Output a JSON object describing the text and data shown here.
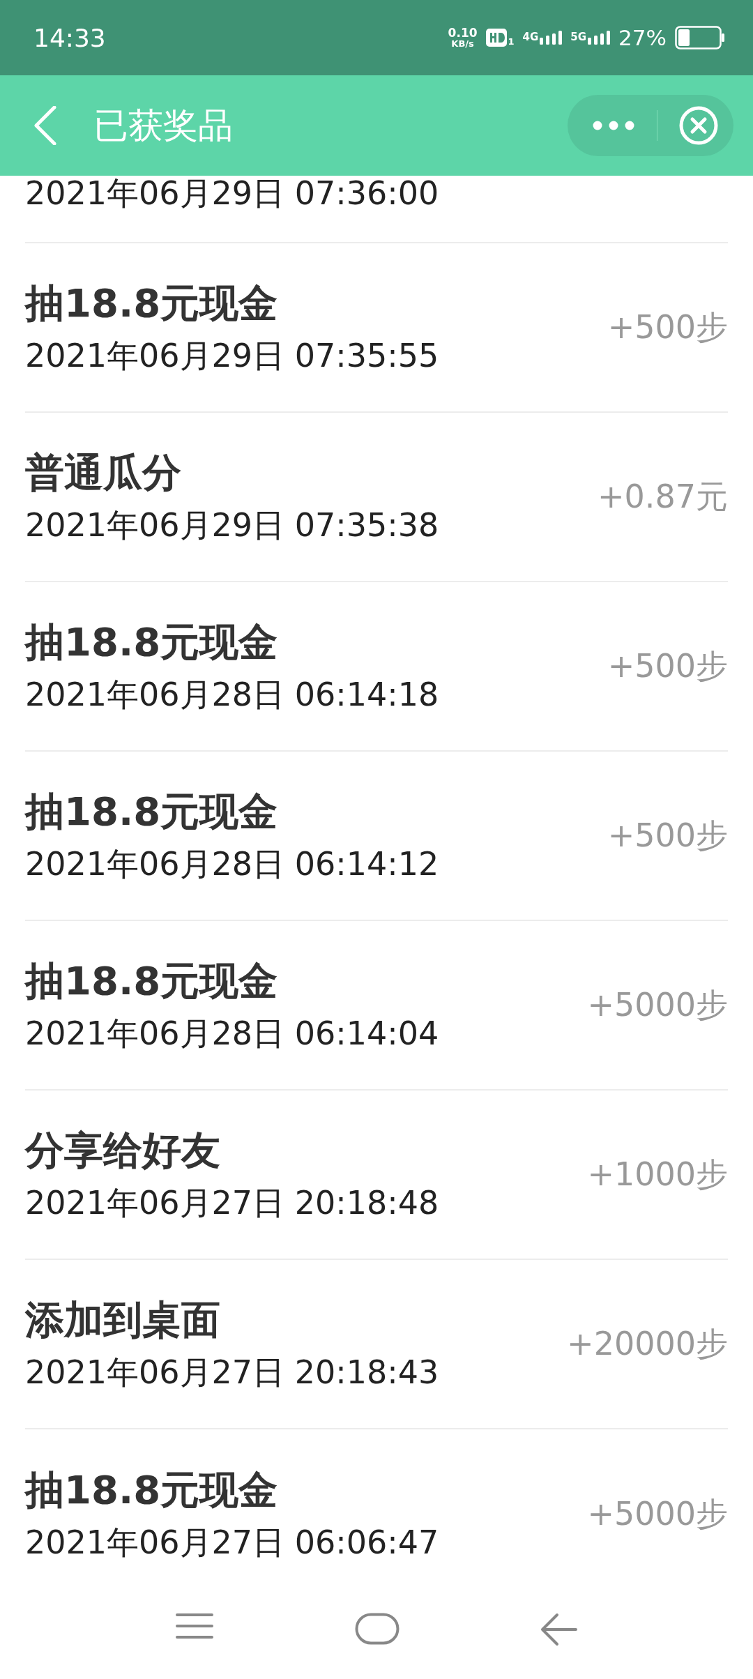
{
  "status_bar": {
    "time": "14:33",
    "net_speed_value": "0.10",
    "net_speed_unit": "KB/s",
    "hd_sub": "1",
    "net_4g": "4G",
    "net_5g": "5G",
    "battery": "27%"
  },
  "header": {
    "title": "已获奖品"
  },
  "records": [
    {
      "kind": "partial",
      "date": "2021年06月29日 07:36:00"
    },
    {
      "kind": "full",
      "title": "抽18.8元现金",
      "date": "2021年06月29日 07:35:55",
      "reward": "+500步"
    },
    {
      "kind": "full",
      "title": "普通瓜分",
      "date": "2021年06月29日 07:35:38",
      "reward": "+0.87元"
    },
    {
      "kind": "full",
      "title": "抽18.8元现金",
      "date": "2021年06月28日 06:14:18",
      "reward": "+500步"
    },
    {
      "kind": "full",
      "title": "抽18.8元现金",
      "date": "2021年06月28日 06:14:12",
      "reward": "+500步"
    },
    {
      "kind": "full",
      "title": "抽18.8元现金",
      "date": "2021年06月28日 06:14:04",
      "reward": "+5000步"
    },
    {
      "kind": "full",
      "title": "分享给好友",
      "date": "2021年06月27日 20:18:48",
      "reward": "+1000步"
    },
    {
      "kind": "full",
      "title": "添加到桌面",
      "date": "2021年06月27日 20:18:43",
      "reward": "+20000步"
    },
    {
      "kind": "full",
      "title": "抽18.8元现金",
      "date": "2021年06月27日 06:06:47",
      "reward": "+5000步"
    }
  ]
}
